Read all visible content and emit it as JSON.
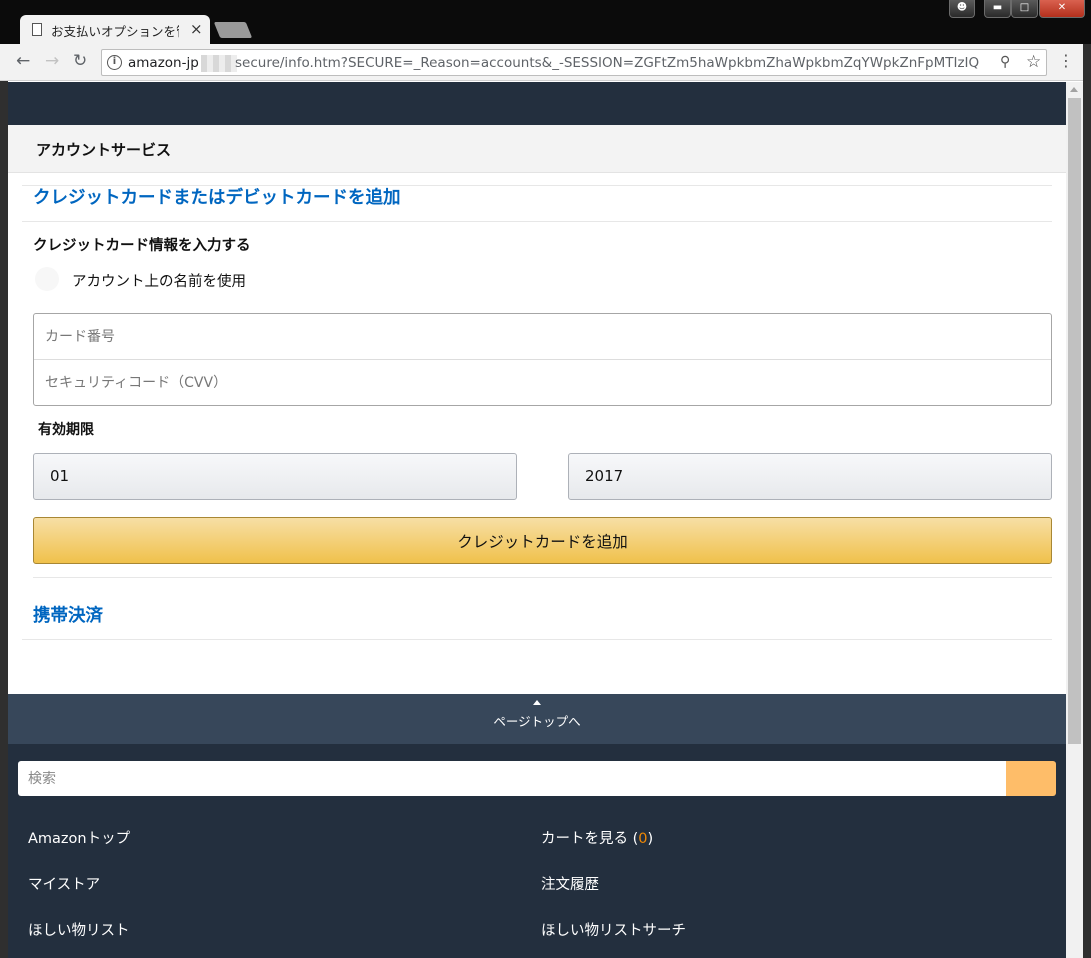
{
  "browser": {
    "tab_title": "お支払いオプションを管",
    "tab_close": "×",
    "url_host": "amazon-jp",
    "url_path": "secure/info.htm?SECURE=_Reason=accounts&_-SESSION=ZGFtZm5haWpkbmZhaWpkbmZqYWpkZnFpMTIzIQ"
  },
  "header": {
    "title": "アカウントサービス"
  },
  "main": {
    "add_card_link": "クレジットカードまたはデビットカードを追加",
    "card_info_heading": "クレジットカード情報を入力する",
    "use_account_name_label": "アカウント上の名前を使用",
    "card_number_placeholder": "カード番号",
    "cvv_placeholder": "セキュリティコード（CVV）",
    "expiry_label": "有効期限",
    "expiry_month": "01",
    "expiry_year": "2017",
    "add_card_button": "クレジットカードを追加",
    "mobile_payment_link": "携帯決済"
  },
  "footer": {
    "back_to_top": "ページトップへ",
    "search_placeholder": "検索",
    "links": {
      "amazon_top": "Amazonトップ",
      "view_cart": "カートを見る (",
      "cart_count": "0",
      "cart_close": ")",
      "my_store": "マイストア",
      "order_history": "注文履歴",
      "wishlist": "ほしい物リスト",
      "wishlist_search": "ほしい物リストサーチ"
    }
  },
  "colors": {
    "nav_bg": "#232f3e",
    "back_to_top_bg": "#37475a",
    "link_blue": "#0066c0",
    "button_yellow": "#f0c14b",
    "search_button": "#febd69",
    "cart_count": "#f08804"
  },
  "icons": [
    "document-icon",
    "close-icon",
    "back-arrow-icon",
    "forward-arrow-icon",
    "reload-icon",
    "info-icon",
    "key-icon",
    "star-icon",
    "menu-icon",
    "caret-up-icon"
  ]
}
